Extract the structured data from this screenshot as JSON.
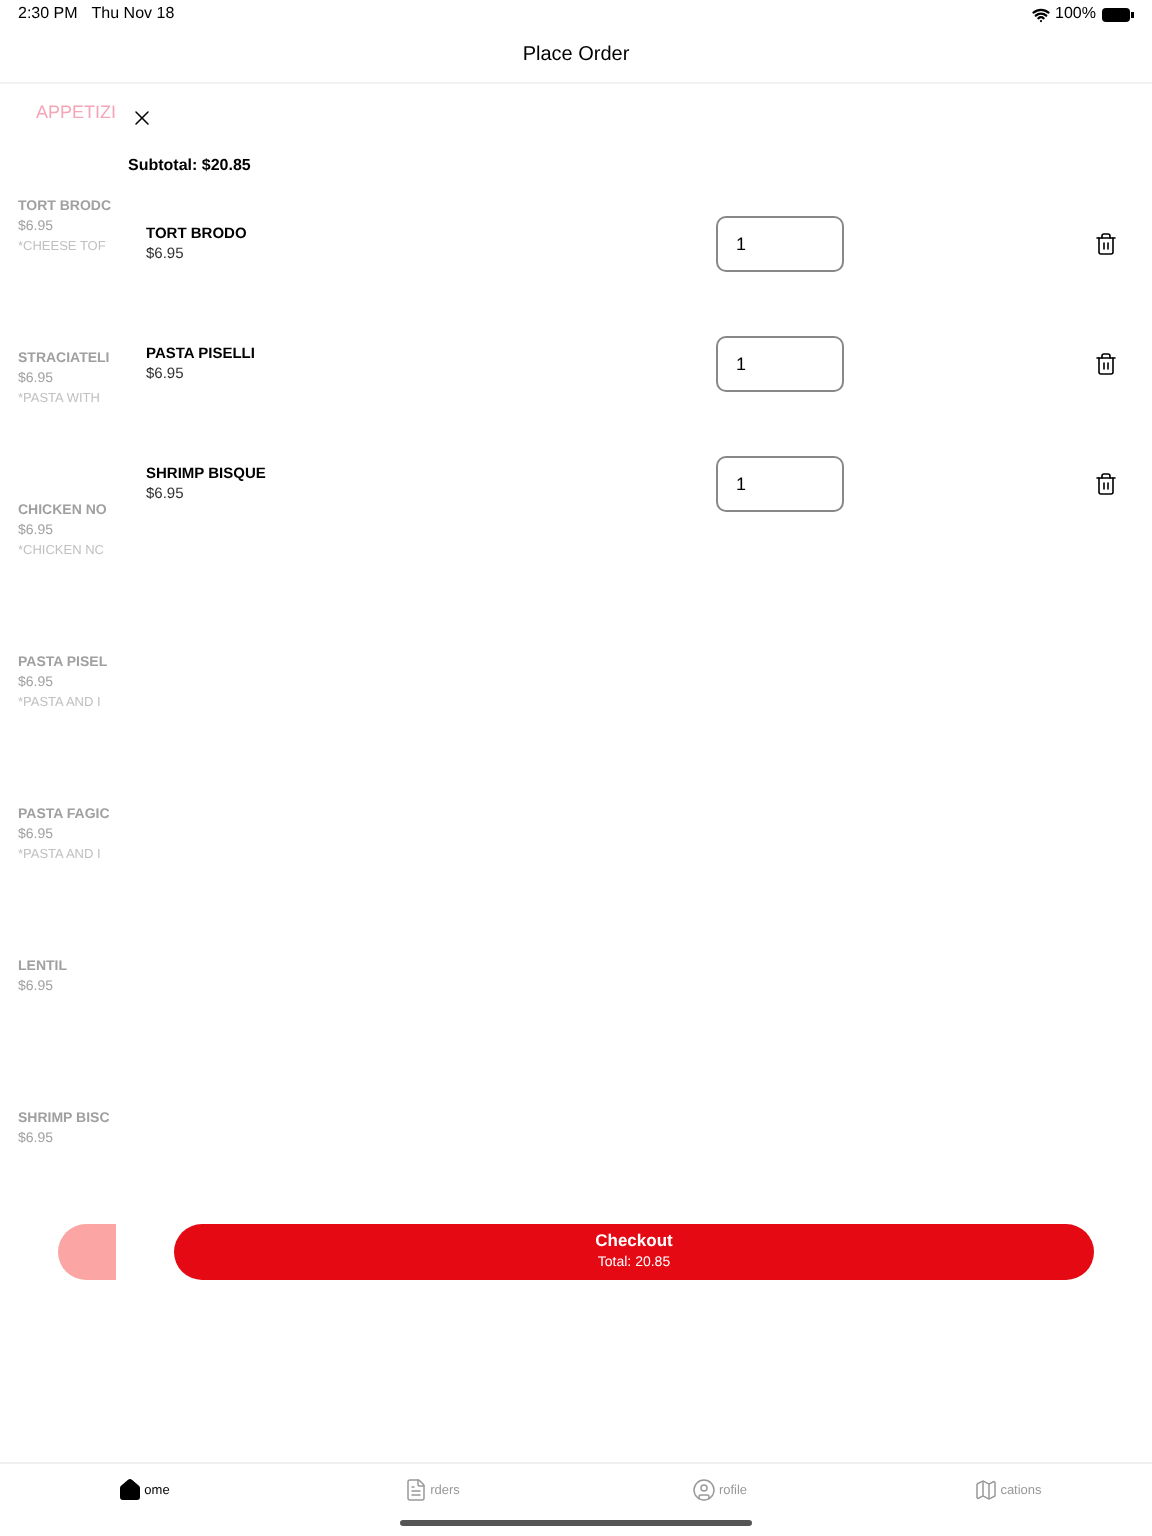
{
  "status_bar": {
    "time": "2:30 PM",
    "date": "Thu Nov 18",
    "battery": "100%"
  },
  "header": {
    "title": "Place Order"
  },
  "menu": {
    "category": "APPETIZI",
    "items": [
      {
        "name": "TORT BRODC",
        "price": "$6.95",
        "description": "*CHEESE TOF"
      },
      {
        "name": "STRACIATELI",
        "price": "$6.95",
        "description": "*PASTA WITH"
      },
      {
        "name": "CHICKEN NO",
        "price": "$6.95",
        "description": "*CHICKEN NC"
      },
      {
        "name": "PASTA PISEL",
        "price": "$6.95",
        "description": "*PASTA AND I"
      },
      {
        "name": "PASTA FAGIC",
        "price": "$6.95",
        "description": "*PASTA AND I"
      },
      {
        "name": "LENTIL",
        "price": "$6.95"
      },
      {
        "name": "SHRIMP BISC",
        "price": "$6.95"
      }
    ]
  },
  "order": {
    "subtotal": "Subtotal: $20.85",
    "items": [
      {
        "name": "TORT BRODO",
        "price": "$6.95",
        "quantity": "1"
      },
      {
        "name": "PASTA PISELLI",
        "price": "$6.95",
        "quantity": "1"
      },
      {
        "name": "SHRIMP BISQUE",
        "price": "$6.95",
        "quantity": "1"
      }
    ],
    "checkout": {
      "label": "Checkout",
      "total": "Total: 20.85"
    }
  },
  "tabs": [
    {
      "kind": "home",
      "label": "ome",
      "selected": true
    },
    {
      "kind": "orders",
      "label": "rders",
      "selected": false
    },
    {
      "kind": "profile",
      "label": "rofile",
      "selected": false
    },
    {
      "kind": "locations",
      "label": "cations",
      "selected": false
    }
  ]
}
